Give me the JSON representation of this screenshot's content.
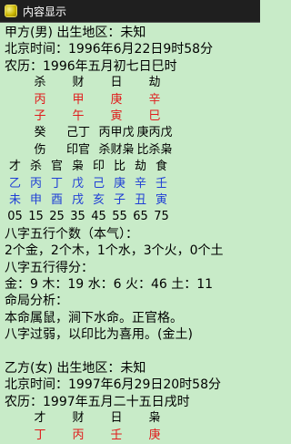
{
  "window": {
    "title": "内容显示"
  },
  "person1": {
    "header": "甲方(男) 出生地区：未知",
    "beijing_time": "北京时间：1996年6月22日9时58分",
    "lunar_time": "农历：1996年五月初七日巳时",
    "main_gods": [
      "杀",
      "财",
      "日",
      "劫"
    ],
    "stems": [
      "丙",
      "甲",
      "庚",
      "辛"
    ],
    "branches": [
      "子",
      "午",
      "寅",
      "巳"
    ],
    "hidden_row1": [
      "癸",
      "己丁",
      "丙甲戊",
      "庚丙戊"
    ],
    "hidden_row2": [
      "伤",
      "印官",
      "杀财枭",
      "比杀枭"
    ],
    "dayun_gods": [
      "才",
      "杀",
      "官",
      "枭",
      "印",
      "比",
      "劫",
      "食"
    ],
    "dayun_stems": [
      "乙",
      "丙",
      "丁",
      "戊",
      "己",
      "庚",
      "辛",
      "壬"
    ],
    "dayun_branches": [
      "未",
      "申",
      "酉",
      "戌",
      "亥",
      "子",
      "丑",
      "寅"
    ],
    "dayun_ages": [
      "05",
      "15",
      "25",
      "35",
      "45",
      "55",
      "65",
      "75"
    ],
    "wuxing_count_title": "八字五行个数（本气）：",
    "wuxing_count": "2个金，2个木，1个水，3个火，0个土",
    "wuxing_score_title": "八字五行得分：",
    "wuxing_score": "金：9 木：19 水：6 火：46 土：11",
    "analysis_title": "命局分析：",
    "analysis_line1": "本命属鼠，涧下水命。正官格。",
    "analysis_line2": "八字过弱，以印比为喜用。(金土)"
  },
  "person2": {
    "header": "乙方(女) 出生地区：未知",
    "beijing_time": "北京时间：1997年6月29日20时58分",
    "lunar_time": "农历：1997年五月二十五日戌时",
    "main_gods": [
      "才",
      "财",
      "日",
      "枭"
    ],
    "stems": [
      "丁",
      "丙",
      "壬",
      "庚"
    ]
  },
  "colors": {
    "background": "#c8ebc8",
    "titlebar": "#1f1f1f",
    "red": "#e01b1b",
    "blue": "#1f3fd6"
  }
}
